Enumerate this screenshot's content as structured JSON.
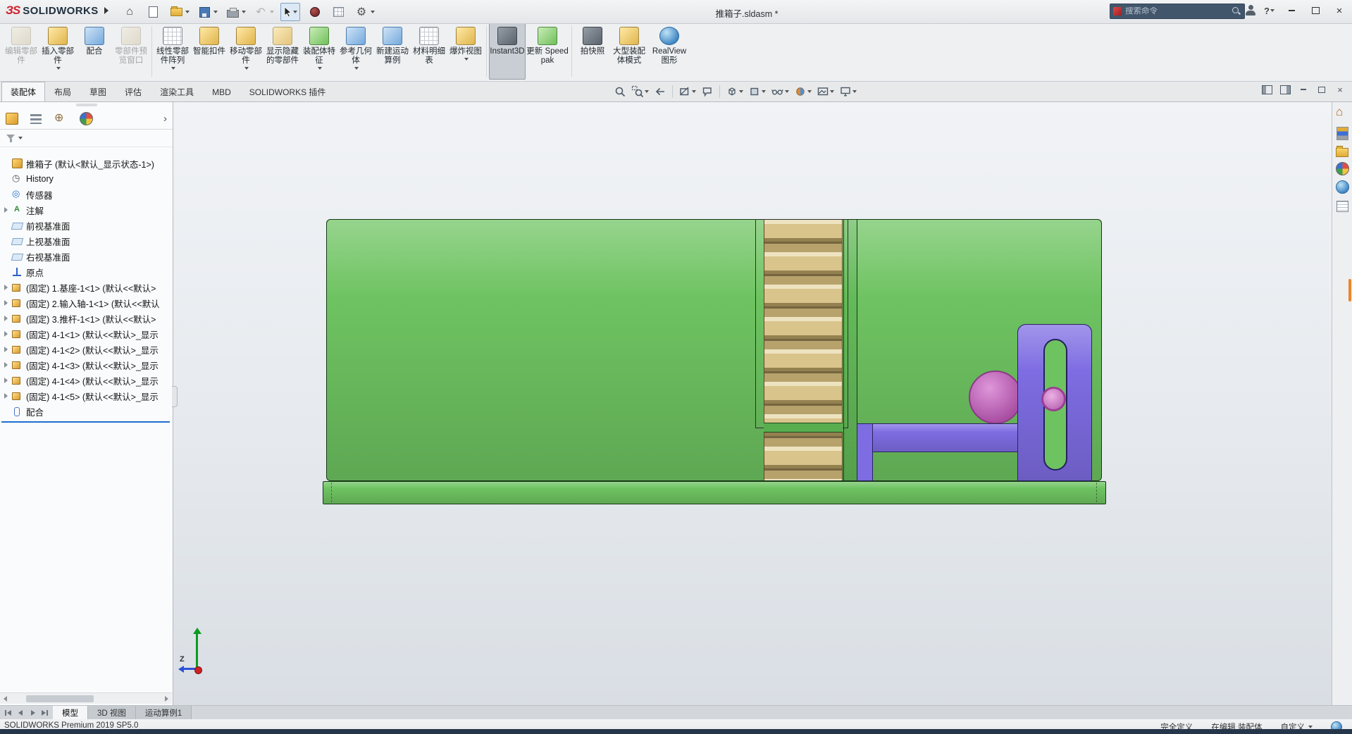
{
  "titlebar": {
    "logo_mark": "ЗS",
    "logo_text": "SOLIDWORKS",
    "document_title": "推箱子.sldasm *",
    "search_placeholder": "搜索命令",
    "help_label": "?"
  },
  "quick_access": {
    "icons": [
      "home-icon",
      "new-document-icon",
      "open-icon",
      "save-icon",
      "print-icon",
      "undo-icon",
      "select-cursor-icon",
      "sphere-icon",
      "evaluate-grid-icon",
      "options-gear-icon"
    ]
  },
  "ribbon": {
    "buttons": [
      {
        "label": "编辑零部件",
        "icon": "edit-component-icon",
        "state": "disabled"
      },
      {
        "label": "插入零部件",
        "icon": "insert-components-icon",
        "dropdown": true
      },
      {
        "label": "配合",
        "icon": "mate-icon"
      },
      {
        "label": "零部件预览窗口",
        "icon": "component-preview-icon",
        "state": "disabled"
      },
      {
        "label": "线性零部件阵列",
        "icon": "linear-pattern-icon",
        "dropdown": true
      },
      {
        "label": "智能扣件",
        "icon": "smart-fasteners-icon"
      },
      {
        "label": "移动零部件",
        "icon": "move-component-icon",
        "dropdown": true
      },
      {
        "label": "显示隐藏的零部件",
        "icon": "show-hidden-components-icon"
      },
      {
        "label": "装配体特征",
        "icon": "assembly-features-icon",
        "dropdown": true
      },
      {
        "label": "参考几何体",
        "icon": "reference-geometry-icon",
        "dropdown": true
      },
      {
        "label": "新建运动算例",
        "icon": "new-motion-study-icon"
      },
      {
        "label": "材料明细表",
        "icon": "bill-of-materials-icon"
      },
      {
        "label": "爆炸视图",
        "icon": "exploded-view-icon",
        "dropdown": true
      },
      {
        "label": "Instant3D",
        "icon": "instant3d-icon",
        "state": "active"
      },
      {
        "label": "更新 Speedpak",
        "icon": "update-speedpak-icon"
      },
      {
        "label": "拍快照",
        "icon": "take-snapshot-icon"
      },
      {
        "label": "大型装配体模式",
        "icon": "large-assembly-mode-icon"
      },
      {
        "label": "RealView 图形",
        "icon": "realview-graphics-icon"
      }
    ],
    "tabs": [
      {
        "label": "装配体",
        "active": true
      },
      {
        "label": "布局"
      },
      {
        "label": "草图"
      },
      {
        "label": "评估"
      },
      {
        "label": "渲染工具"
      },
      {
        "label": "MBD"
      },
      {
        "label": "SOLIDWORKS 插件"
      }
    ]
  },
  "headsup": {
    "icons": [
      "zoom-to-fit-icon",
      "zoom-to-area-icon",
      "previous-view-icon",
      "section-view-icon",
      "dynamic-annotation-icon",
      "view-orientation-icon",
      "display-style-icon",
      "hide-show-items-icon",
      "edit-appearance-icon",
      "apply-scene-icon",
      "view-settings-icon"
    ]
  },
  "feature_tree": {
    "items": [
      {
        "label": "推箱子 (默认<默认_显示状态-1>)",
        "icon": "assembly-icon"
      },
      {
        "label": "History",
        "icon": "history-icon"
      },
      {
        "label": "传感器",
        "icon": "sensors-icon"
      },
      {
        "label": "注解",
        "icon": "annotations-icon",
        "expandable": true
      },
      {
        "label": "前视基准面",
        "icon": "plane-icon"
      },
      {
        "label": "上视基准面",
        "icon": "plane-icon"
      },
      {
        "label": "右视基准面",
        "icon": "plane-icon"
      },
      {
        "label": "原点",
        "icon": "origin-icon"
      },
      {
        "label": "(固定) 1.基座-1<1> (默认<<默认>",
        "icon": "part-icon",
        "expandable": true
      },
      {
        "label": "(固定) 2.输入轴-1<1> (默认<<默认",
        "icon": "part-icon",
        "expandable": true
      },
      {
        "label": "(固定) 3.推杆-1<1> (默认<<默认>",
        "icon": "part-icon",
        "expandable": true
      },
      {
        "label": "(固定) 4-1<1> (默认<<默认>_显示",
        "icon": "part-icon",
        "expandable": true
      },
      {
        "label": "(固定) 4-1<2> (默认<<默认>_显示",
        "icon": "part-icon",
        "expandable": true
      },
      {
        "label": "(固定) 4-1<3> (默认<<默认>_显示",
        "icon": "part-icon",
        "expandable": true
      },
      {
        "label": "(固定) 4-1<4> (默认<<默认>_显示",
        "icon": "part-icon",
        "expandable": true
      },
      {
        "label": "(固定) 4-1<5> (默认<<默认>_显示",
        "icon": "part-icon",
        "expandable": true
      },
      {
        "label": "配合",
        "icon": "mates-icon"
      }
    ]
  },
  "viewport": {
    "triad": {
      "z_label": "Z"
    },
    "colors": {
      "body": "#6EC361",
      "base": "#6EC361",
      "rack": "#D9C48C",
      "strip": "#63BA58",
      "crossband": "#58AE4F",
      "bracket": "#7E6CE2",
      "slot": "#6EC361",
      "wheel": "#CD5EC5",
      "pin": "#DD7BD4"
    }
  },
  "task_pane": {
    "icons": [
      "home-icon",
      "design-library-icon",
      "file-explorer-icon",
      "appearances-icon",
      "scene-icon",
      "custom-properties-icon"
    ]
  },
  "doc_tabs": {
    "items": [
      {
        "label": "模型",
        "active": true
      },
      {
        "label": "3D 视图"
      },
      {
        "label": "运动算例1"
      }
    ]
  },
  "status_bar": {
    "product": "SOLIDWORKS Premium 2019 SP5.0",
    "definition": "完全定义",
    "editing": "在编辑 装配体",
    "customize": "自定义"
  }
}
